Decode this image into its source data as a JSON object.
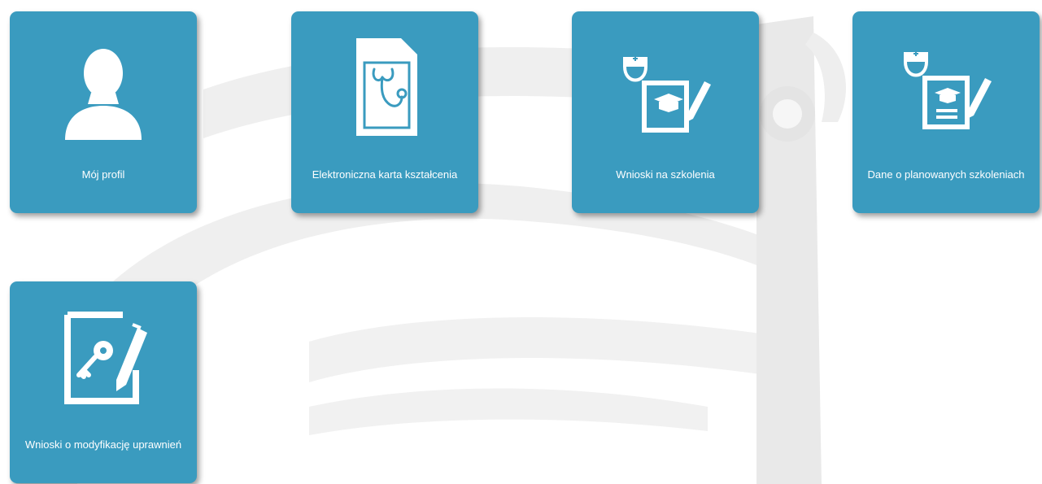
{
  "colors": {
    "tile_background": "#3a9bbf",
    "tile_text": "#ffffff",
    "background": "#ffffff",
    "watermark": "#ececec"
  },
  "tiles": [
    {
      "label": "Mój profil",
      "icon": "user-silhouette-icon"
    },
    {
      "label": "Elektroniczna karta kształcenia",
      "icon": "stethoscope-card-icon"
    },
    {
      "label": "Wnioski na szkolenia",
      "icon": "nurse-cap-application-icon"
    },
    {
      "label": "Dane o planowanych szkoleniach",
      "icon": "nurse-cap-planned-application-icon"
    },
    {
      "label": "Wnioski o modyfikację uprawnień",
      "icon": "key-pen-document-icon"
    }
  ]
}
